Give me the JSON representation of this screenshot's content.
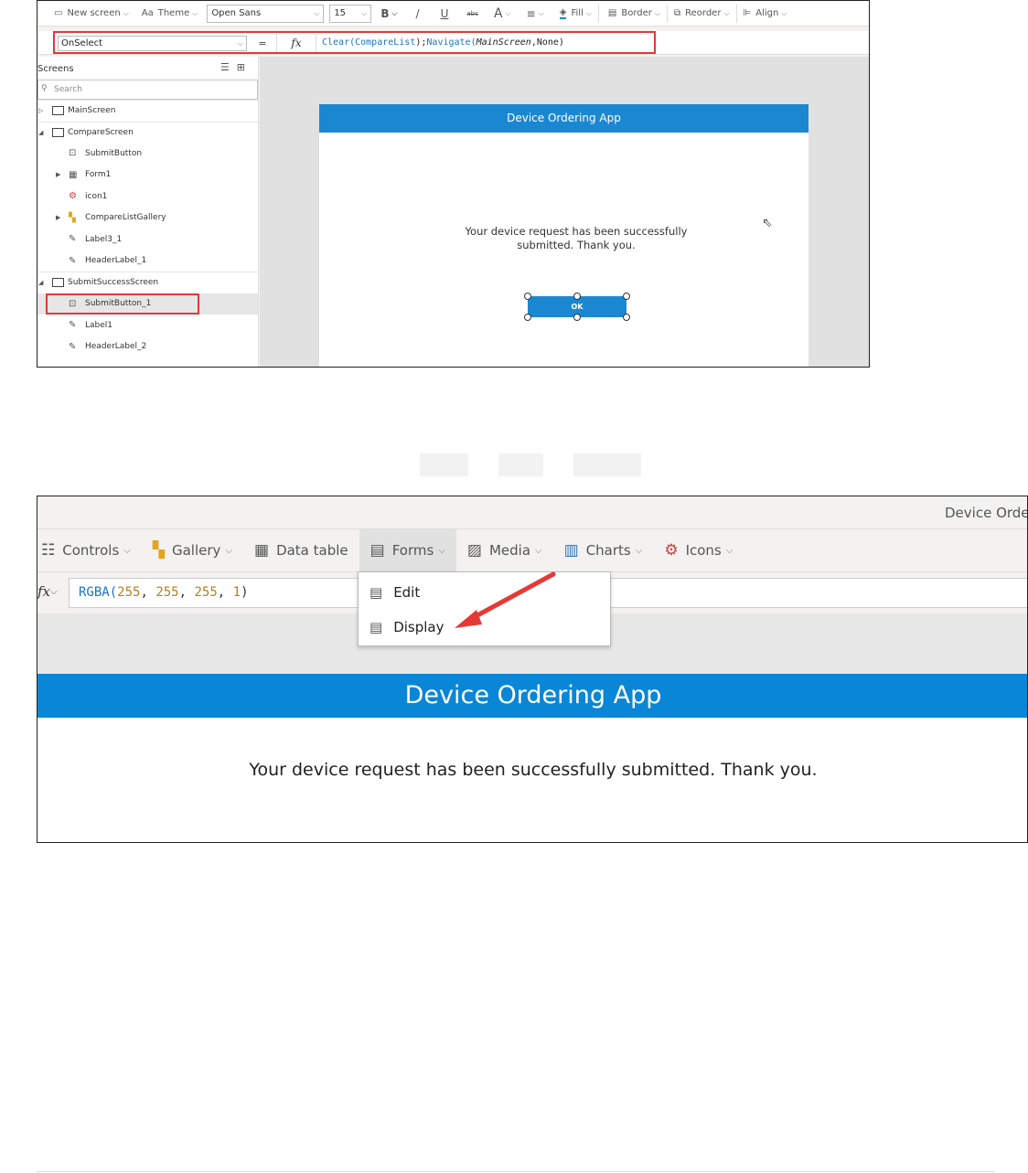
{
  "shot1": {
    "ribbon": {
      "new_screen": "New screen",
      "theme": "Theme",
      "font": "Open Sans",
      "font_size": "15",
      "bold": "B",
      "italic": "/",
      "underline": "U",
      "strike": "abc",
      "font_color": "A",
      "fill": "Fill",
      "border": "Border",
      "reorder": "Reorder",
      "align": "Align"
    },
    "formula_bar": {
      "property": "OnSelect",
      "equals": "=",
      "fx": "fx",
      "formula_parts": {
        "clear": "Clear(",
        "comparelist": "CompareList",
        "close1": ");",
        "navigate": "Navigate(",
        "mainscreen": "MainScreen",
        "rest": ",None)"
      }
    },
    "tree": {
      "title": "Screens",
      "search_placeholder": "Search",
      "items": [
        {
          "label": "MainScreen"
        },
        {
          "label": "CompareScreen"
        },
        {
          "label": "SubmitButton"
        },
        {
          "label": "Form1"
        },
        {
          "label": "icon1"
        },
        {
          "label": "CompareListGallery"
        },
        {
          "label": "Label3_1"
        },
        {
          "label": "HeaderLabel_1"
        },
        {
          "label": "SubmitSuccessScreen"
        },
        {
          "label": "SubmitButton_1"
        },
        {
          "label": "Label1"
        },
        {
          "label": "HeaderLabel_2"
        }
      ]
    },
    "app": {
      "header": "Device Ordering App",
      "message": "Your device request has been successfully submitted. Thank you.",
      "ok_label": "OK"
    }
  },
  "shot2": {
    "app_title": "Device Order",
    "insert_bar": {
      "controls": "Controls",
      "gallery": "Gallery",
      "data_table": "Data table",
      "forms": "Forms",
      "media": "Media",
      "charts": "Charts",
      "icons": "Icons"
    },
    "formula_bar": {
      "fx": "fx",
      "fn": "RGBA(",
      "n1": "255",
      "n2": "255",
      "n3": "255",
      "n4": "1",
      "sep": ", ",
      "close": ")"
    },
    "forms_menu": {
      "edit": "Edit",
      "display": "Display"
    },
    "app": {
      "header": "Device Ordering App",
      "message": "Your device request has been successfully submitted. Thank you."
    }
  },
  "colors": {
    "brand_blue": "#1b87d1",
    "highlight_red": "#e03a3a"
  }
}
